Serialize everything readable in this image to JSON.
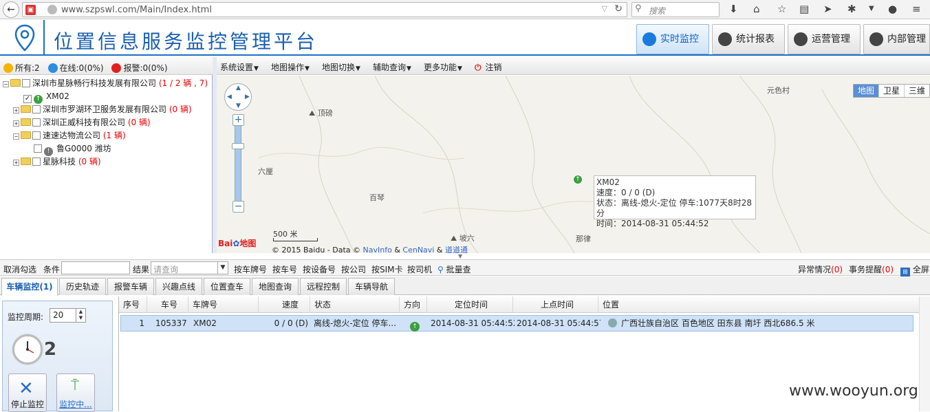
{
  "browser": {
    "url": "www.szpswl.com/Main/Index.html",
    "search_placeholder": "搜索"
  },
  "header": {
    "title": "位置信息服务监控管理平台",
    "tabs": [
      {
        "label": "实时监控"
      },
      {
        "label": "统计报表"
      },
      {
        "label": "运营管理"
      },
      {
        "label": "内部管理"
      }
    ]
  },
  "legend": {
    "all": "所有:2",
    "online": "在线:0(0%)",
    "alarm": "报警:0(0%)"
  },
  "tree": [
    {
      "name": "深圳市星脉畅行科技发展有限公司",
      "count": "(1 / 2 辆 , 7)"
    },
    {
      "name": "XM02",
      "count": ""
    },
    {
      "name": "深圳市罗湖环卫服务发展有限公司",
      "count": "(0 辆)"
    },
    {
      "name": "深圳正威科技有限公司",
      "count": "(0 辆)"
    },
    {
      "name": "速速达物流公司",
      "count": "(1 辆)"
    },
    {
      "name": "鲁G0000 潍坊",
      "count": ""
    },
    {
      "name": "星脉科技",
      "count": "(0 辆)"
    }
  ],
  "map_toolbar": {
    "system": "系统设置",
    "map_ops": "地图操作",
    "map_switch": "地图切换",
    "assist": "辅助查询",
    "more": "更多功能",
    "logout": "注销"
  },
  "map": {
    "places": [
      "顶磅",
      "六厘",
      "百琴",
      "坡六",
      "那律",
      "元色村"
    ],
    "types": [
      "地图",
      "卫星",
      "三维"
    ],
    "scale": "500 米",
    "baidu": "地图",
    "copyright": "© 2015 Baidu - Data ©",
    "navinfo": "NavInfo",
    "amp": "&",
    "cennavi": "CenNavi",
    "daotong": "道道通",
    "info": {
      "plate": "XM02",
      "speed": "速度：0 / 0 (D)",
      "status": "状态：离线-熄火-定位 停车:1077天8时28分",
      "time": "时间：2014-08-31 05:44:52"
    }
  },
  "query": {
    "cancel": "取消勾选",
    "cond": "条件",
    "result": "结果",
    "result_placeholder": "请查询",
    "by_plate": "按车牌号",
    "by_car": "按车号",
    "by_device": "按设备号",
    "by_company": "按公司",
    "by_sim": "按SIM卡",
    "by_driver": "按司机",
    "batch": "批量查",
    "abnormal": "异常情况",
    "abnormal_count": "(0)",
    "reminder": "事务提醒",
    "reminder_count": "(0)",
    "fullscreen": "全屏"
  },
  "bottom_tabs": [
    "车辆监控(1)",
    "历史轨迹",
    "报警车辆",
    "兴趣点线",
    "位置查车",
    "地图查询",
    "远程控制",
    "车辆导航"
  ],
  "monitor": {
    "period_label": "监控周期:",
    "period_value": "20",
    "count": "2",
    "stop": "停止监控",
    "monitoring": "监控中..."
  },
  "grid": {
    "headers": [
      "序号",
      "车号",
      "车牌号",
      "速度",
      "状态",
      "方向",
      "定位时间",
      "上点时间",
      "位置"
    ],
    "rows": [
      {
        "index": "1",
        "car_no": "105337",
        "plate": "XM02",
        "speed": "0 / 0 (D)",
        "status": "离线-熄火-定位 停车...",
        "locate_time": "2014-08-31 05:44:52",
        "report_time": "2014-08-31 05:44:57",
        "position": "广西壮族自治区 百色地区 田东县 南圩 西北686.5 米"
      }
    ]
  },
  "watermark": "www.wooyun.org",
  "colors": {
    "brand": "#1a5fb0",
    "accent": "#1a7ae0",
    "alarm": "#e00000",
    "online_icon": "#3ba03b"
  }
}
